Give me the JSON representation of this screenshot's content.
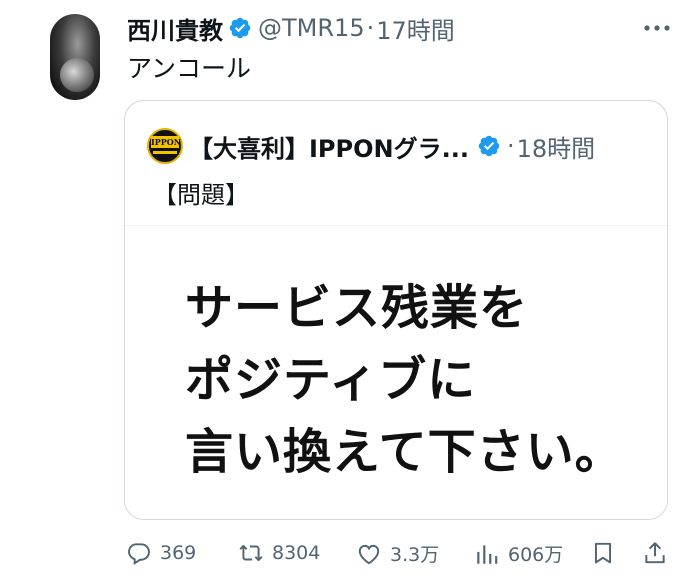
{
  "tweet": {
    "author_name": "西川貴教",
    "handle": "@TMR15",
    "separator": "·",
    "time": "17時間",
    "text": "アンコール"
  },
  "quote": {
    "author_name": "【大喜利】IPPONグラ...",
    "separator": "·",
    "time": "18時間",
    "text": "【問題】",
    "image_lines": [
      "サービス残業を",
      "ポジティブに",
      "言い換えて下さい。"
    ]
  },
  "actions": {
    "replies": "369",
    "reposts": "8304",
    "likes": "3.3万",
    "views": "606万"
  },
  "colors": {
    "verified": "#1d9bf0",
    "muted": "#536471",
    "text": "#0f1419",
    "border": "#cfd9de"
  },
  "icons": [
    "more-icon",
    "verified-icon",
    "reply-icon",
    "retweet-icon",
    "like-icon",
    "views-icon",
    "bookmark-icon",
    "share-icon"
  ]
}
